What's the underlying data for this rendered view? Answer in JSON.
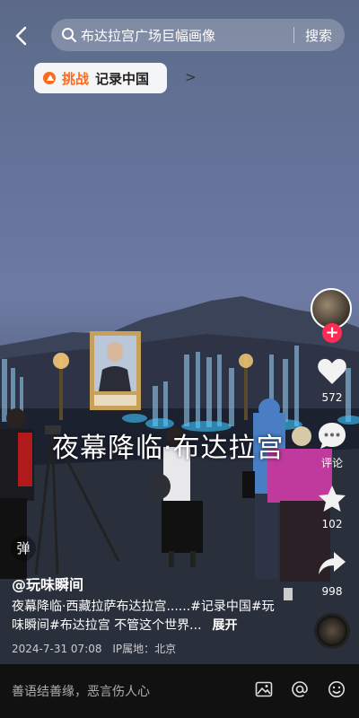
{
  "search": {
    "query": "布达拉宫广场巨幅画像",
    "button": "搜索"
  },
  "challenge": {
    "tag": "挑战",
    "text": "记录中国",
    "chevron": ">"
  },
  "video": {
    "overlay_title": "夜幕降临·布达拉宫"
  },
  "rail": {
    "likes": "572",
    "comments": "评论",
    "favorites": "102",
    "shares": "998",
    "follow": "+"
  },
  "danmu": {
    "label": "弹"
  },
  "post": {
    "author": "@玩味瞬间",
    "description": "夜幕降临·西藏拉萨布达拉宫......#记录中国#玩味瞬间#布达拉宫 不管这个世界...",
    "expand": "展开",
    "date": "2024-7-31 07:08",
    "ip": "IP属地：北京"
  },
  "comment_bar": {
    "placeholder": "善语结善缘，恶言伤人心"
  }
}
